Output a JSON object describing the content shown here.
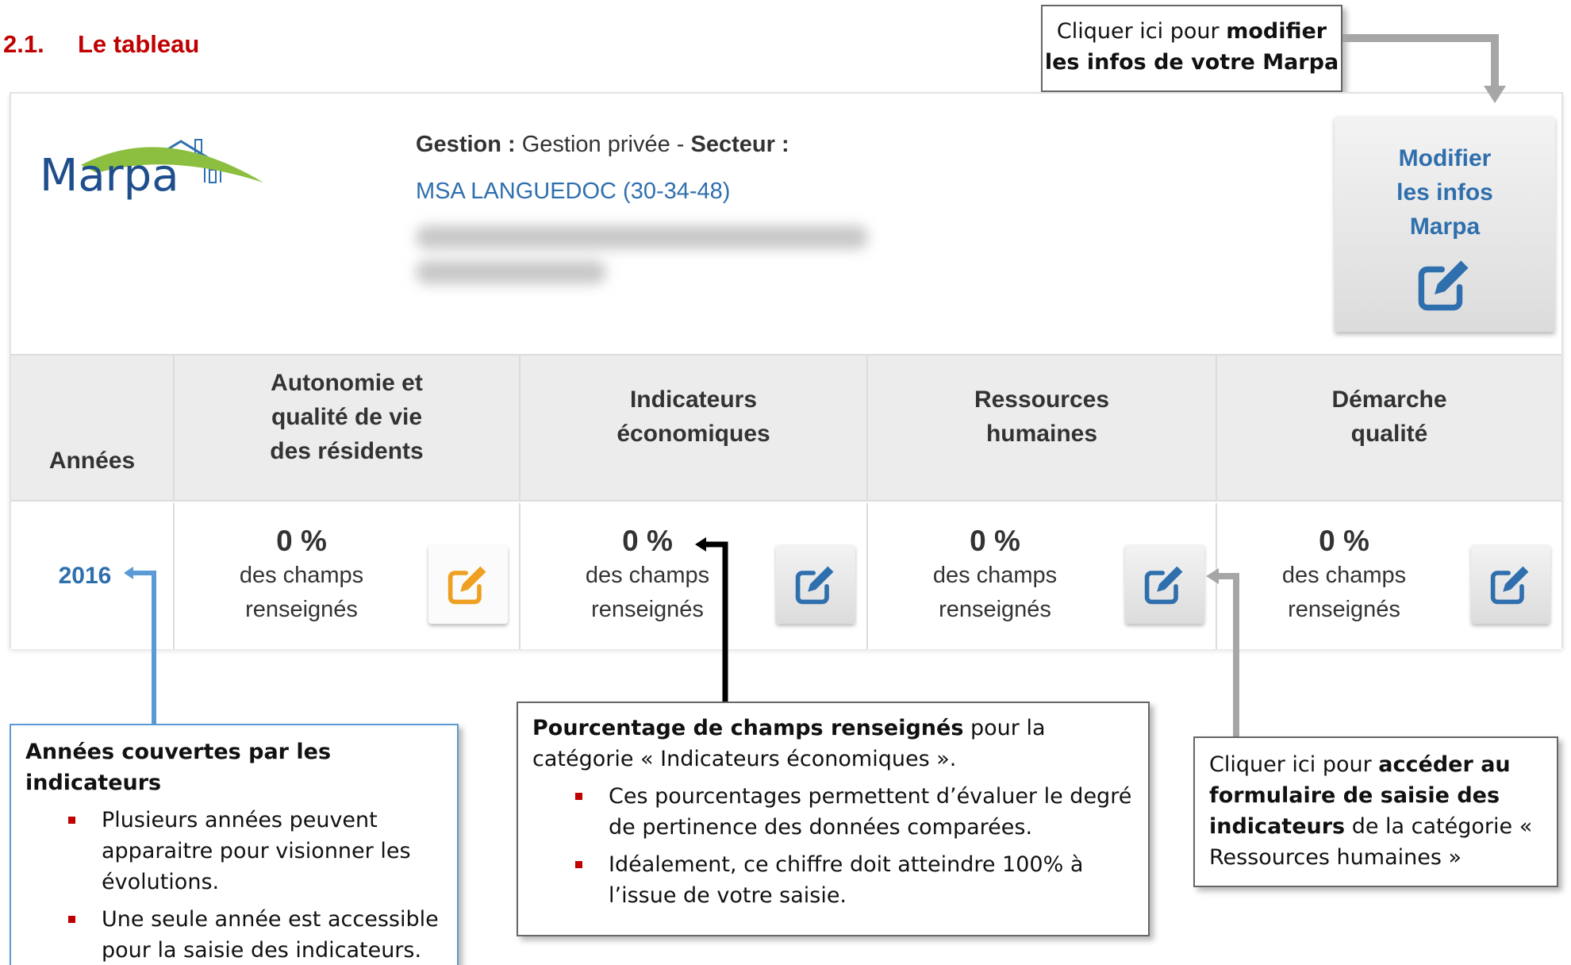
{
  "heading": {
    "number": "2.1.",
    "title": "Le tableau"
  },
  "callout_top": {
    "prefix": "Cliquer ici pour ",
    "bold1": "modifier",
    "bold2": "les infos de votre Marpa"
  },
  "logo": {
    "brand_text": "Marpa"
  },
  "info": {
    "gestion_label": "Gestion :",
    "gestion_value": "Gestion privée",
    "secteur_label": "Secteur :",
    "organisation": "MSA LANGUEDOC (30-34-48)"
  },
  "modify_button": {
    "line1": "Modifier",
    "line2": "les infos",
    "line3": "Marpa"
  },
  "table": {
    "header_years": "Années",
    "categories": [
      {
        "lines": [
          "Autonomie et",
          "qualité de vie",
          "des résidents"
        ],
        "percent": "0 %",
        "text1": "des champs",
        "text2": "renseignés",
        "active": true
      },
      {
        "lines": [
          "Indicateurs",
          "économiques"
        ],
        "percent": "0 %",
        "text1": "des champs",
        "text2": "renseignés",
        "active": false
      },
      {
        "lines": [
          "Ressources",
          "humaines"
        ],
        "percent": "0 %",
        "text1": "des champs",
        "text2": "renseignés",
        "active": false
      },
      {
        "lines": [
          "Démarche",
          "qualité"
        ],
        "percent": "0 %",
        "text1": "des champs",
        "text2": "renseignés",
        "active": false
      }
    ],
    "year": "2016"
  },
  "callout_left": {
    "title": "Années couvertes par les indicateurs",
    "bullets": [
      "Plusieurs années peuvent apparaitre pour visionner les évolutions.",
      "Une seule année est accessible pour la saisie des indicateurs."
    ]
  },
  "callout_mid": {
    "title_bold": "Pourcentage de champs renseignés",
    "title_rest": " pour la catégorie « Indicateurs économiques ».",
    "bullets": [
      "Ces pourcentages permettent d’évaluer le degré de pertinence des données comparées.",
      "Idéalement, ce chiffre doit atteindre 100% à l’issue de votre saisie."
    ]
  },
  "callout_right": {
    "t1": "Cliquer ici pour ",
    "b1": "accéder au formulaire de saisie des indicateurs",
    "t2": " de la catégorie « Ressources humaines »"
  },
  "colors": {
    "heading": "#c00000",
    "link": "#2f6fae",
    "edit_active": "#f0a020",
    "edit_icon": "#2f6fae",
    "arrow_blue": "#5b9bd5",
    "arrow_gray": "#a6a6a6",
    "arrow_black": "#000000"
  },
  "icons": {
    "edit": "edit-square-icon"
  }
}
